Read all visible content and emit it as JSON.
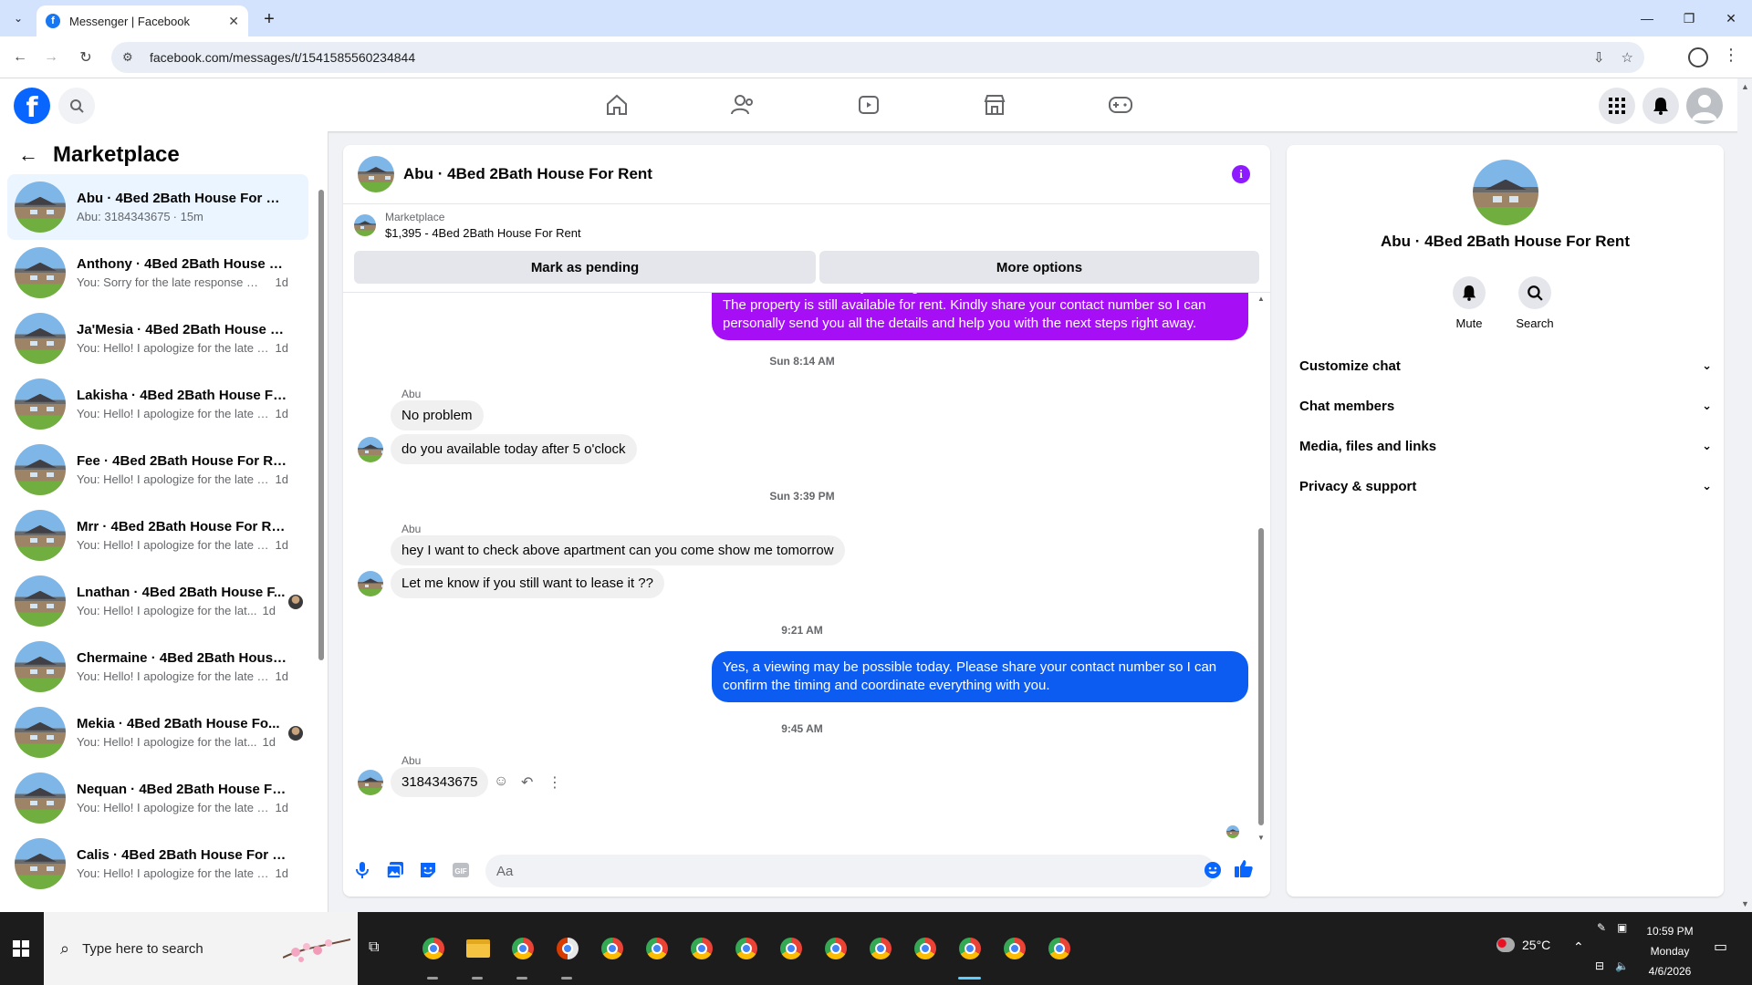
{
  "browser": {
    "tab_title": "Messenger | Facebook",
    "url": "facebook.com/messages/t/1541585560234844"
  },
  "sidebar": {
    "title": "Marketplace",
    "conversations": [
      {
        "name": "Abu · 4Bed 2Bath House For Rent",
        "preview": "Abu: 3184343675",
        "time": "· 15m",
        "active": true
      },
      {
        "name": "Anthony · 4Bed 2Bath House Fo...",
        "preview": "You: Sorry for the late response — ...",
        "time": "1d"
      },
      {
        "name": "Ja'Mesia · 4Bed 2Bath House Fo...",
        "preview": "You: Hello! I apologize for the late r...",
        "time": "1d"
      },
      {
        "name": "Lakisha · 4Bed 2Bath House For ...",
        "preview": "You: Hello! I apologize for the late r...",
        "time": "1d"
      },
      {
        "name": "Fee · 4Bed 2Bath House For Rent",
        "preview": "You: Hello! I apologize for the late r...",
        "time": "1d"
      },
      {
        "name": "Mrr · 4Bed 2Bath House For Rent",
        "preview": "You: Hello! I apologize for the late r...",
        "time": "1d"
      },
      {
        "name": "Lnathan · 4Bed 2Bath House F...",
        "preview": "You: Hello! I apologize for the lat...",
        "time": "1d",
        "read_avatar": true
      },
      {
        "name": "Chermaine · 4Bed 2Bath House ...",
        "preview": "You: Hello! I apologize for the late r...",
        "time": "1d"
      },
      {
        "name": "Mekia · 4Bed 2Bath House Fo...",
        "preview": "You: Hello! I apologize for the lat...",
        "time": "1d",
        "read_avatar": true
      },
      {
        "name": "Nequan · 4Bed 2Bath House For...",
        "preview": "You: Hello! I apologize for the late r...",
        "time": "1d"
      },
      {
        "name": "Calis · 4Bed 2Bath House For Rent",
        "preview": "You: Hello! I apologize for the late r...",
        "time": "1d"
      }
    ]
  },
  "chat": {
    "title": "Abu · 4Bed 2Bath House For Rent",
    "listing_source": "Marketplace",
    "listing": "$1,395 - 4Bed 2Bath House For Rent",
    "mark_pending": "Mark as pending",
    "more_options": "More options",
    "out_msg_1": "recovered access to my messages.\nThe property is still available for rent. Kindly share your contact number so I can personally send you all the details and help you with the next steps right away.",
    "ts_1": "Sun 8:14 AM",
    "sender_1": "Abu",
    "in_msg_1": "No problem",
    "in_msg_2": "do you available today after 5 o'clock",
    "ts_2": "Sun 3:39 PM",
    "sender_2": "Abu",
    "in_msg_3": "hey I want to check above apartment can you come show me tomorrow",
    "in_msg_4": "Let me know if you still want to lease it ??",
    "ts_3": "9:21 AM",
    "out_msg_2": "Yes, a viewing may be possible today. Please share your contact number so I can confirm the timing and coordinate everything with you.",
    "ts_4": "9:45 AM",
    "sender_3": "Abu",
    "in_msg_5": "3184343675",
    "composer_placeholder": "Aa",
    "colors": {
      "out_purple": "#a60ff5",
      "out_blue": "#0d5cf2",
      "accent": "#8e1bff"
    }
  },
  "details": {
    "name": "Abu · 4Bed 2Bath House For Rent",
    "mute": "Mute",
    "search": "Search",
    "rows": [
      "Customize chat",
      "Chat members",
      "Media, files and links",
      "Privacy & support"
    ]
  },
  "taskbar": {
    "search_placeholder": "Type here to search",
    "temperature": "25°C",
    "time": "10:59 PM",
    "day": "Monday",
    "date": "4/6/2026"
  }
}
